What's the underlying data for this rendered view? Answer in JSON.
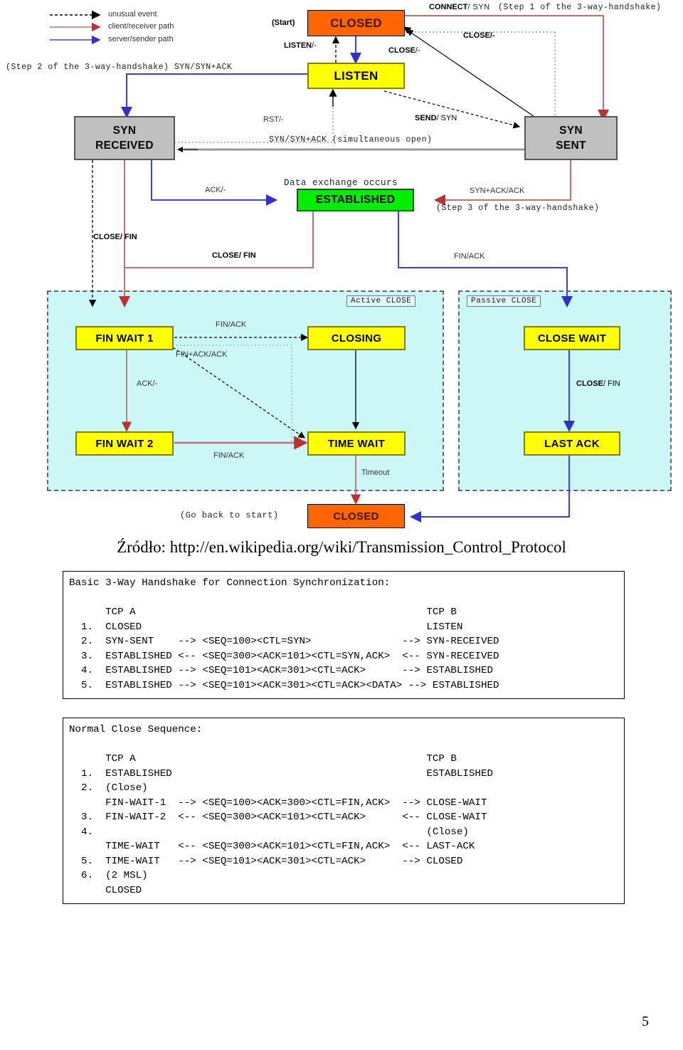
{
  "document": {
    "source_line": "Źródło: http://en.wikipedia.org/wiki/Transmission_Control_Protocol",
    "page_number": "5"
  },
  "diagram": {
    "legend": [
      {
        "label": "unusual event",
        "style": "dashed-black"
      },
      {
        "label": "client/receiver path",
        "style": "solid-red"
      },
      {
        "label": "server/sender path",
        "style": "solid-blue"
      }
    ],
    "states": [
      {
        "id": "closed-top",
        "label": "CLOSED",
        "color": "#FF6600"
      },
      {
        "id": "listen",
        "label": "LISTEN",
        "color": "#FFFF00"
      },
      {
        "id": "syn-received",
        "label": "SYN\nRECEIVED",
        "color": "#C0C0C0"
      },
      {
        "id": "syn-sent",
        "label": "SYN\nSENT",
        "color": "#C0C0C0"
      },
      {
        "id": "established",
        "label": "ESTABLISHED",
        "color": "#00EE00"
      },
      {
        "id": "fin-wait-1",
        "label": "FIN WAIT 1",
        "color": "#FFFF00"
      },
      {
        "id": "closing",
        "label": "CLOSING",
        "color": "#FFFF00"
      },
      {
        "id": "close-wait",
        "label": "CLOSE WAIT",
        "color": "#FFFF00"
      },
      {
        "id": "fin-wait-2",
        "label": "FIN WAIT 2",
        "color": "#FFFF00"
      },
      {
        "id": "time-wait",
        "label": "TIME WAIT",
        "color": "#FFFF00"
      },
      {
        "id": "last-ack",
        "label": "LAST ACK",
        "color": "#FFFF00"
      },
      {
        "id": "closed-bottom",
        "label": "CLOSED",
        "color": "#FF6600"
      }
    ],
    "regions": [
      {
        "id": "active-close",
        "tag": "Active CLOSE"
      },
      {
        "id": "passive-close",
        "tag": "Passive CLOSE"
      }
    ],
    "annotations": {
      "start": "(Start)",
      "connect_syn_bold": "CONNECT",
      "connect_syn_rest": "/ SYN",
      "step1": "(Step 1 of the 3-way-handshake)",
      "listen_minus_bold": "LISTEN",
      "listen_minus_rest": "/-",
      "close_minus_right": "CLOSE/-",
      "close_minus_mid_bold": "CLOSE",
      "close_minus_mid_rest": "/-",
      "step2": "(Step 2 of the 3-way-handshake) SYN/SYN+ACK",
      "rst_minus": "RST/-",
      "send_syn_bold": "SEND",
      "send_syn_rest": "/ SYN",
      "simultaneous_open": "SYN/SYN+ACK  (simultaneous open)",
      "ack_minus_left": "ACK/-",
      "data_exchange": "Data exchange occurs",
      "syn_ack_ack": "SYN+ACK/ACK",
      "step3": "(Step 3 of the 3-way-handshake)",
      "close_fin_far_left": "CLOSE/ FIN",
      "close_fin_mid": "CLOSE/ FIN",
      "fin_ack_mid_right": "FIN/ACK",
      "fin_ack_top": "FIN/ACK",
      "fin_ack_ack": "FIN+ACK/ACK",
      "ack_minus_fw": "ACK/-",
      "fin_ack_bottom": "FIN/ACK",
      "close_fin_right_bold": "CLOSE",
      "close_fin_right_rest": "/ FIN",
      "timeout": "Timeout",
      "go_back": "(Go back to start)"
    }
  },
  "handshake_box": {
    "title": "Basic 3-Way Handshake for Connection Synchronization:",
    "text": "Basic 3-Way Handshake for Connection Synchronization:\n\n      TCP A                                                TCP B\n  1.  CLOSED                                               LISTEN\n  2.  SYN-SENT    --> <SEQ=100><CTL=SYN>               --> SYN-RECEIVED\n  3.  ESTABLISHED <-- <SEQ=300><ACK=101><CTL=SYN,ACK>  <-- SYN-RECEIVED\n  4.  ESTABLISHED --> <SEQ=101><ACK=301><CTL=ACK>      --> ESTABLISHED\n  5.  ESTABLISHED --> <SEQ=101><ACK=301><CTL=ACK><DATA> --> ESTABLISHED"
  },
  "close_box": {
    "title": "Normal Close Sequence:",
    "text": "Normal Close Sequence:\n\n      TCP A                                                TCP B\n  1.  ESTABLISHED                                          ESTABLISHED\n  2.  (Close)\n      FIN-WAIT-1  --> <SEQ=100><ACK=300><CTL=FIN,ACK>  --> CLOSE-WAIT\n  3.  FIN-WAIT-2  <-- <SEQ=300><ACK=101><CTL=ACK>      <-- CLOSE-WAIT\n  4.                                                       (Close)\n      TIME-WAIT   <-- <SEQ=300><ACK=101><CTL=FIN,ACK>  <-- LAST-ACK\n  5.  TIME-WAIT   --> <SEQ=101><ACK=301><CTL=ACK>      --> CLOSED\n  6.  (2 MSL)\n      CLOSED"
  }
}
